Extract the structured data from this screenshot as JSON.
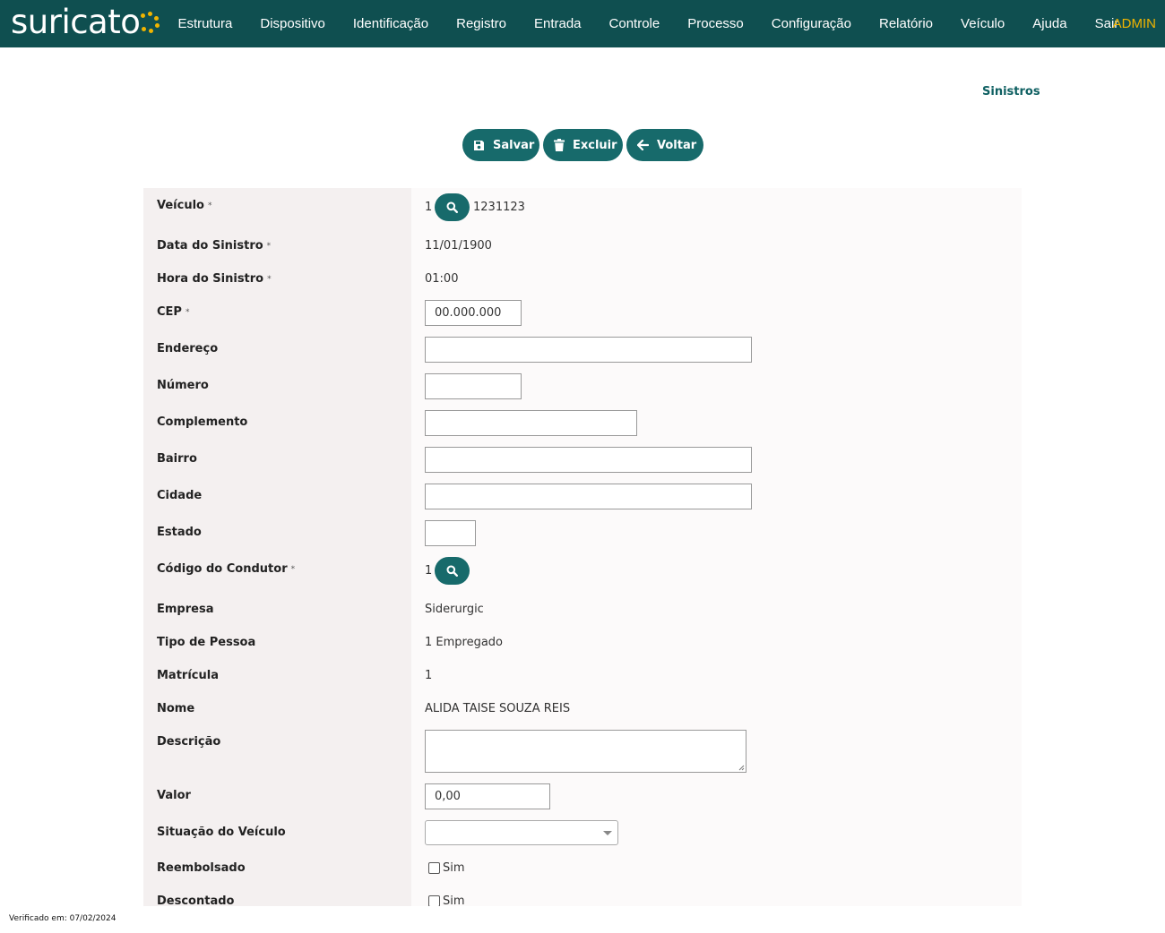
{
  "app": {
    "logo_text": "suricato"
  },
  "nav": {
    "items": [
      "Estrutura",
      "Dispositivo",
      "Identificação",
      "Registro",
      "Entrada",
      "Controle",
      "Processo",
      "Configuração",
      "Relatório",
      "Veículo",
      "Ajuda",
      "Sair"
    ],
    "user": "ADMIN"
  },
  "page": {
    "title": "Sinistros"
  },
  "actions": {
    "save": "Salvar",
    "delete": "Excluir",
    "back": "Voltar"
  },
  "form": {
    "veiculo": {
      "label": "Veículo",
      "required": "*",
      "value": "1",
      "extra": "1231123"
    },
    "data_sinistro": {
      "label": "Data do Sinistro",
      "required": "*",
      "value": "11/01/1900"
    },
    "hora_sinistro": {
      "label": "Hora do Sinistro",
      "required": "*",
      "value": "01:00"
    },
    "cep": {
      "label": "CEP",
      "required": "*",
      "value": "00.000.000"
    },
    "endereco": {
      "label": "Endereço",
      "value": ""
    },
    "numero": {
      "label": "Número",
      "value": ""
    },
    "complemento": {
      "label": "Complemento",
      "value": ""
    },
    "bairro": {
      "label": "Bairro",
      "value": ""
    },
    "cidade": {
      "label": "Cidade",
      "value": ""
    },
    "estado": {
      "label": "Estado",
      "value": ""
    },
    "codigo_condutor": {
      "label": "Código do Condutor",
      "required": "*",
      "value": "1"
    },
    "empresa": {
      "label": "Empresa",
      "value": "Siderurgic"
    },
    "tipo_pessoa": {
      "label": "Tipo de Pessoa",
      "value": "1 Empregado"
    },
    "matricula": {
      "label": "Matrícula",
      "value": "1"
    },
    "nome": {
      "label": "Nome",
      "value": "ALIDA TAISE SOUZA REIS"
    },
    "descricao": {
      "label": "Descrição",
      "value": ""
    },
    "valor": {
      "label": "Valor",
      "value": "0,00"
    },
    "situacao_veiculo": {
      "label": "Situação do Veículo",
      "value": ""
    },
    "reembolsado": {
      "label": "Reembolsado",
      "option": "Sim",
      "checked": false
    },
    "descontado": {
      "label": "Descontado",
      "option": "Sim",
      "checked": false
    }
  },
  "footer": {
    "text": "Verificado em: 07/02/2024"
  },
  "colors": {
    "header_bg": "#0f4f50",
    "accent": "#176a6b",
    "admin": "#f0b400",
    "title": "#0f6062"
  }
}
